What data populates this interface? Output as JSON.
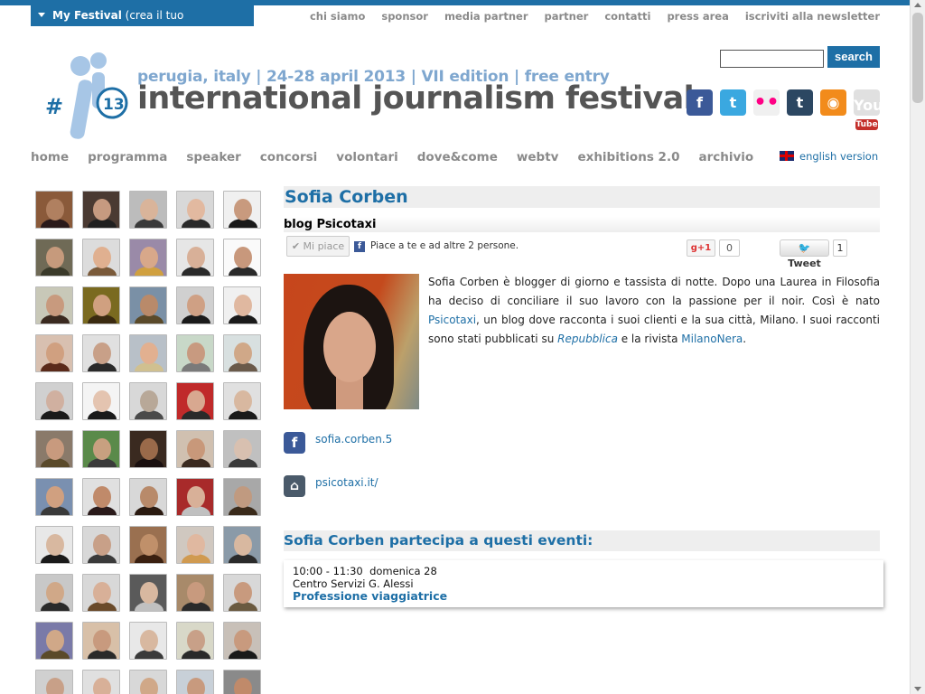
{
  "colors": {
    "accent": "#1e6fa6",
    "nav_grey": "#8a8a8a",
    "tagline": "#7fa7cf"
  },
  "my_festival": {
    "label": "My Festival",
    "sub": "(crea il tuo programma)"
  },
  "top_nav": [
    "chi siamo",
    "sponsor",
    "media partner",
    "partner",
    "contatti",
    "press area",
    "iscriviti alla newsletter"
  ],
  "search": {
    "value": "",
    "button": "search"
  },
  "logo": {
    "hash": "#",
    "letters": "jf",
    "number": "13"
  },
  "header": {
    "tagline": "perugia, italy | 24-28 april 2013 | VII edition | free entry",
    "title": "international journalism festival"
  },
  "social_icons": [
    {
      "name": "facebook-icon",
      "glyph": "f"
    },
    {
      "name": "twitter-icon",
      "glyph": "t"
    },
    {
      "name": "flickr-icon",
      "glyph": "••"
    },
    {
      "name": "tumblr-icon",
      "glyph": "t"
    },
    {
      "name": "rss-icon",
      "glyph": "◉"
    },
    {
      "name": "youtube-icon",
      "glyph": "You",
      "glyph2": "Tube"
    }
  ],
  "main_nav": [
    "home",
    "programma",
    "speaker",
    "concorsi",
    "volontari",
    "dove&come",
    "webtv",
    "exhibitions 2.0",
    "archivio"
  ],
  "english_version": "english version",
  "speaker": {
    "name": "Sofia Corben",
    "subtitle": "blog Psicotaxi",
    "like_button": "✔ Mi piace",
    "like_text": "Piace a te e ad altre 2 persone.",
    "gplus_label": "+1",
    "gplus_count": "0",
    "tweet_label": "Tweet",
    "tweet_count": "1",
    "bio": {
      "part1": "Sofia Corben è blogger di giorno e tassista di notte. Dopo una Laurea in Filosofia ha deciso di conciliare il suo lavoro con la passione per il noir. Così è nato ",
      "link1": "Psicotaxi",
      "part2": ", un blog dove racconta i suoi clienti e la sua città, Milano. I suoi racconti sono stati pubblicati su ",
      "link2": "Repubblica",
      "part3": " e la rivista ",
      "link3": "MilanoNera",
      "part4": "."
    },
    "facebook_link": "sofia.corben.5",
    "website_link": "psicotaxi.it/",
    "events_heading": "Sofia Corben partecipa a questi eventi:",
    "events": [
      {
        "time": "10:00 - 11:30",
        "day": "domenica 28",
        "place": "Centro Servizi G. Alessi",
        "title": "Professione viaggiatrice"
      }
    ]
  },
  "faces": [
    [
      "#8a5a3a",
      "#b08060",
      "#2a1a1a"
    ],
    [
      "#4a3a32",
      "#c69a80",
      "#202020"
    ],
    [
      "#bcbcbc",
      "#d9b49a",
      "#3a3a3a"
    ],
    [
      "#d8d8d8",
      "#e2b9a0",
      "#2a2a2a"
    ],
    [
      "#f0f0f0",
      "#c89a7e",
      "#1a1a1a"
    ],
    [
      "#6f6a56",
      "#c69a7c",
      "#3a3a2a"
    ],
    [
      "#dcdcdc",
      "#e0b090",
      "#7a5a3a"
    ],
    [
      "#9a8aa8",
      "#d8a88a",
      "#d0a040"
    ],
    [
      "#e6e6e6",
      "#d8b098",
      "#2a2a2a"
    ],
    [
      "#fafafa",
      "#c8987c",
      "#2a2a2a"
    ],
    [
      "#c8c8b8",
      "#c89a7e",
      "#3a2a20"
    ],
    [
      "#7a6a20",
      "#d0a080",
      "#3a2a10"
    ],
    [
      "#7a90a6",
      "#b98a6a",
      "#5a4a2a"
    ],
    [
      "#d0d0d0",
      "#cfa084",
      "#1a1a1a"
    ],
    [
      "#f0f0f0",
      "#e0b8a0",
      "#1a1a1a"
    ],
    [
      "#d8c0b0",
      "#d0a080",
      "#5a2a1a"
    ],
    [
      "#e0e0e0",
      "#c8a088",
      "#2a2a2a"
    ],
    [
      "#b8c0c8",
      "#e2b090",
      "#d0c090"
    ],
    [
      "#c8d8c8",
      "#c89a80",
      "#7a7a7a"
    ],
    [
      "#d8e0e0",
      "#d0a888",
      "#6a5a4a"
    ],
    [
      "#d0d0d0",
      "#d0b0a0",
      "#1a1a1a"
    ],
    [
      "#f4f4f4",
      "#e4c4b0",
      "#1a1a1a"
    ],
    [
      "#d8d8d8",
      "#b8a898",
      "#4a4a4a"
    ],
    [
      "#c02a2a",
      "#d8a890",
      "#2a2a2a"
    ],
    [
      "#e0e0e0",
      "#d8b8a0",
      "#1a1a1a"
    ],
    [
      "#8a7a6a",
      "#c89a7e",
      "#5a4a2a"
    ],
    [
      "#5a8a4a",
      "#c8a080",
      "#3a3a3a"
    ],
    [
      "#3a2a20",
      "#9a6a4a",
      "#1a1010"
    ],
    [
      "#d0c0b0",
      "#c8987a",
      "#3a2a20"
    ],
    [
      "#c0c0c0",
      "#d8c0b0",
      "#3a3a3a"
    ],
    [
      "#7a90b0",
      "#d0a080",
      "#3a3a3a"
    ],
    [
      "#e0e0e0",
      "#c08a6a",
      "#2a1a1a"
    ],
    [
      "#d8d8d8",
      "#b88a6a",
      "#2a1a10"
    ],
    [
      "#a82a2a",
      "#d8b098",
      "#c0c0c0"
    ],
    [
      "#a8a8a8",
      "#c09a80",
      "#3a2a1a"
    ],
    [
      "#e8e8e8",
      "#d8b8a0",
      "#1a1a1a"
    ],
    [
      "#d8d8d8",
      "#c8a088",
      "#3a3a3a"
    ],
    [
      "#9a7050",
      "#c0906a",
      "#3a2010"
    ],
    [
      "#d0c8c0",
      "#e0b8a0",
      "#d09a50"
    ],
    [
      "#8a9aa8",
      "#d8b8a0",
      "#2a2a2a"
    ],
    [
      "#c8c8c8",
      "#d0a888",
      "#2a2a2a"
    ],
    [
      "#d8d8d8",
      "#d8b098",
      "#6a4a2a"
    ],
    [
      "#5a5a5a",
      "#d8b8a0",
      "#c0c0c0"
    ],
    [
      "#a88a6a",
      "#c89a7e",
      "#2a2a2a"
    ],
    [
      "#d8d8d8",
      "#c89a7e",
      "#6a5a40"
    ],
    [
      "#7a7aa8",
      "#d0a888",
      "#5a4a2a"
    ],
    [
      "#d8c0a8",
      "#c89a7e",
      "#2a2a2a"
    ],
    [
      "#e8e8e8",
      "#d8b8a0",
      "#3a3a3a"
    ],
    [
      "#d8d8c8",
      "#c8a088",
      "#2a2a2a"
    ],
    [
      "#c8c0b8",
      "#c89a7e",
      "#1a1a1a"
    ],
    [
      "#d0d0d0",
      "#c8a088",
      "#8a8a8a"
    ],
    [
      "#e0e0e0",
      "#d8b098",
      "#3a3a3a"
    ],
    [
      "#d8d8d8",
      "#d0a888",
      "#1a1a1a"
    ],
    [
      "#c8d0d8",
      "#c89a7e",
      "#2a2a2a"
    ],
    [
      "#8a8a8a",
      "#c08a6a",
      "#1a1a1a"
    ]
  ]
}
